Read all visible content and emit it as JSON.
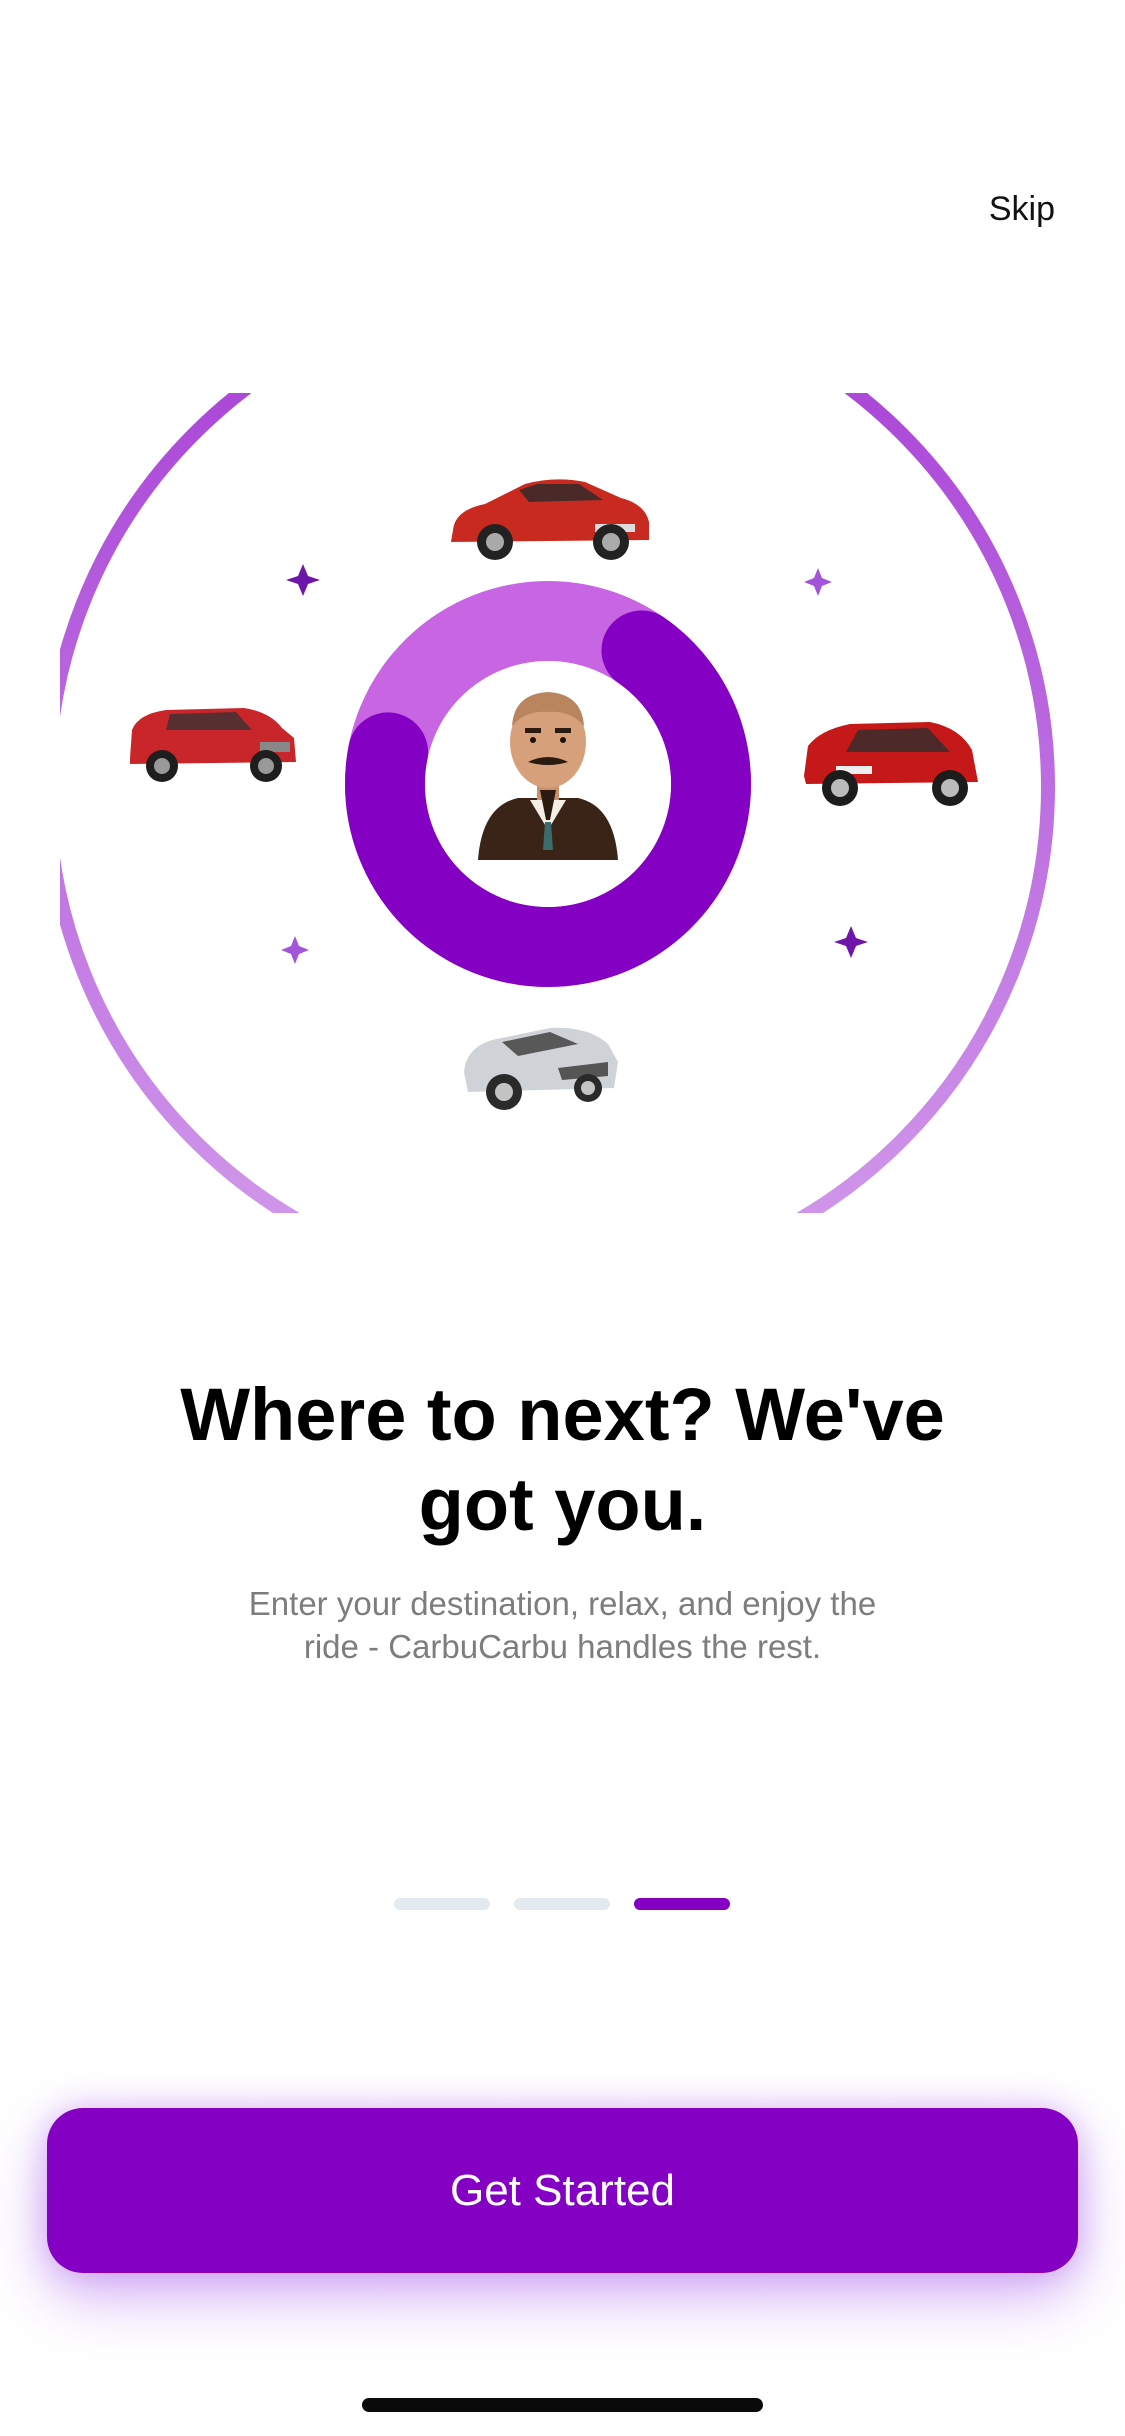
{
  "header": {
    "skip_label": "Skip"
  },
  "colors": {
    "brand": "#8400C2",
    "ring_light": "#C765E3",
    "sparkle": "#7C1FB3",
    "dot_inactive": "#E4E8EF",
    "dot_active": "#8400C2"
  },
  "hero": {
    "icons": [
      "red-classic-car-icon",
      "red-suv-icon",
      "red-hatchback-icon",
      "silver-sports-car-icon",
      "avatar-man-icon",
      "sparkle-icon"
    ]
  },
  "onboarding": {
    "title_line1": "Where to next? We've",
    "title_line2": "got you.",
    "subtitle_line1": "Enter your destination, relax, and enjoy the",
    "subtitle_line2": "ride - CarbuCarbu handles the rest."
  },
  "pager": {
    "total": 3,
    "active_index": 2
  },
  "cta": {
    "label": "Get Started"
  }
}
